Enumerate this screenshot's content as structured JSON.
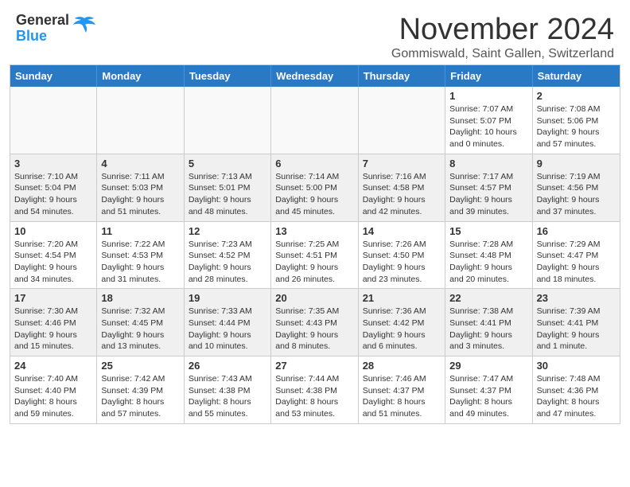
{
  "header": {
    "logo_text_general": "General",
    "logo_text_blue": "Blue",
    "month_title": "November 2024",
    "location": "Gommiswald, Saint Gallen, Switzerland"
  },
  "day_headers": [
    "Sunday",
    "Monday",
    "Tuesday",
    "Wednesday",
    "Thursday",
    "Friday",
    "Saturday"
  ],
  "weeks": [
    [
      {
        "num": "",
        "info": "",
        "empty": true
      },
      {
        "num": "",
        "info": "",
        "empty": true
      },
      {
        "num": "",
        "info": "",
        "empty": true
      },
      {
        "num": "",
        "info": "",
        "empty": true
      },
      {
        "num": "",
        "info": "",
        "empty": true
      },
      {
        "num": "1",
        "info": "Sunrise: 7:07 AM\nSunset: 5:07 PM\nDaylight: 10 hours\nand 0 minutes."
      },
      {
        "num": "2",
        "info": "Sunrise: 7:08 AM\nSunset: 5:06 PM\nDaylight: 9 hours\nand 57 minutes."
      }
    ],
    [
      {
        "num": "3",
        "info": "Sunrise: 7:10 AM\nSunset: 5:04 PM\nDaylight: 9 hours\nand 54 minutes."
      },
      {
        "num": "4",
        "info": "Sunrise: 7:11 AM\nSunset: 5:03 PM\nDaylight: 9 hours\nand 51 minutes."
      },
      {
        "num": "5",
        "info": "Sunrise: 7:13 AM\nSunset: 5:01 PM\nDaylight: 9 hours\nand 48 minutes."
      },
      {
        "num": "6",
        "info": "Sunrise: 7:14 AM\nSunset: 5:00 PM\nDaylight: 9 hours\nand 45 minutes."
      },
      {
        "num": "7",
        "info": "Sunrise: 7:16 AM\nSunset: 4:58 PM\nDaylight: 9 hours\nand 42 minutes."
      },
      {
        "num": "8",
        "info": "Sunrise: 7:17 AM\nSunset: 4:57 PM\nDaylight: 9 hours\nand 39 minutes."
      },
      {
        "num": "9",
        "info": "Sunrise: 7:19 AM\nSunset: 4:56 PM\nDaylight: 9 hours\nand 37 minutes."
      }
    ],
    [
      {
        "num": "10",
        "info": "Sunrise: 7:20 AM\nSunset: 4:54 PM\nDaylight: 9 hours\nand 34 minutes."
      },
      {
        "num": "11",
        "info": "Sunrise: 7:22 AM\nSunset: 4:53 PM\nDaylight: 9 hours\nand 31 minutes."
      },
      {
        "num": "12",
        "info": "Sunrise: 7:23 AM\nSunset: 4:52 PM\nDaylight: 9 hours\nand 28 minutes."
      },
      {
        "num": "13",
        "info": "Sunrise: 7:25 AM\nSunset: 4:51 PM\nDaylight: 9 hours\nand 26 minutes."
      },
      {
        "num": "14",
        "info": "Sunrise: 7:26 AM\nSunset: 4:50 PM\nDaylight: 9 hours\nand 23 minutes."
      },
      {
        "num": "15",
        "info": "Sunrise: 7:28 AM\nSunset: 4:48 PM\nDaylight: 9 hours\nand 20 minutes."
      },
      {
        "num": "16",
        "info": "Sunrise: 7:29 AM\nSunset: 4:47 PM\nDaylight: 9 hours\nand 18 minutes."
      }
    ],
    [
      {
        "num": "17",
        "info": "Sunrise: 7:30 AM\nSunset: 4:46 PM\nDaylight: 9 hours\nand 15 minutes."
      },
      {
        "num": "18",
        "info": "Sunrise: 7:32 AM\nSunset: 4:45 PM\nDaylight: 9 hours\nand 13 minutes."
      },
      {
        "num": "19",
        "info": "Sunrise: 7:33 AM\nSunset: 4:44 PM\nDaylight: 9 hours\nand 10 minutes."
      },
      {
        "num": "20",
        "info": "Sunrise: 7:35 AM\nSunset: 4:43 PM\nDaylight: 9 hours\nand 8 minutes."
      },
      {
        "num": "21",
        "info": "Sunrise: 7:36 AM\nSunset: 4:42 PM\nDaylight: 9 hours\nand 6 minutes."
      },
      {
        "num": "22",
        "info": "Sunrise: 7:38 AM\nSunset: 4:41 PM\nDaylight: 9 hours\nand 3 minutes."
      },
      {
        "num": "23",
        "info": "Sunrise: 7:39 AM\nSunset: 4:41 PM\nDaylight: 9 hours\nand 1 minute."
      }
    ],
    [
      {
        "num": "24",
        "info": "Sunrise: 7:40 AM\nSunset: 4:40 PM\nDaylight: 8 hours\nand 59 minutes."
      },
      {
        "num": "25",
        "info": "Sunrise: 7:42 AM\nSunset: 4:39 PM\nDaylight: 8 hours\nand 57 minutes."
      },
      {
        "num": "26",
        "info": "Sunrise: 7:43 AM\nSunset: 4:38 PM\nDaylight: 8 hours\nand 55 minutes."
      },
      {
        "num": "27",
        "info": "Sunrise: 7:44 AM\nSunset: 4:38 PM\nDaylight: 8 hours\nand 53 minutes."
      },
      {
        "num": "28",
        "info": "Sunrise: 7:46 AM\nSunset: 4:37 PM\nDaylight: 8 hours\nand 51 minutes."
      },
      {
        "num": "29",
        "info": "Sunrise: 7:47 AM\nSunset: 4:37 PM\nDaylight: 8 hours\nand 49 minutes."
      },
      {
        "num": "30",
        "info": "Sunrise: 7:48 AM\nSunset: 4:36 PM\nDaylight: 8 hours\nand 47 minutes."
      }
    ]
  ]
}
